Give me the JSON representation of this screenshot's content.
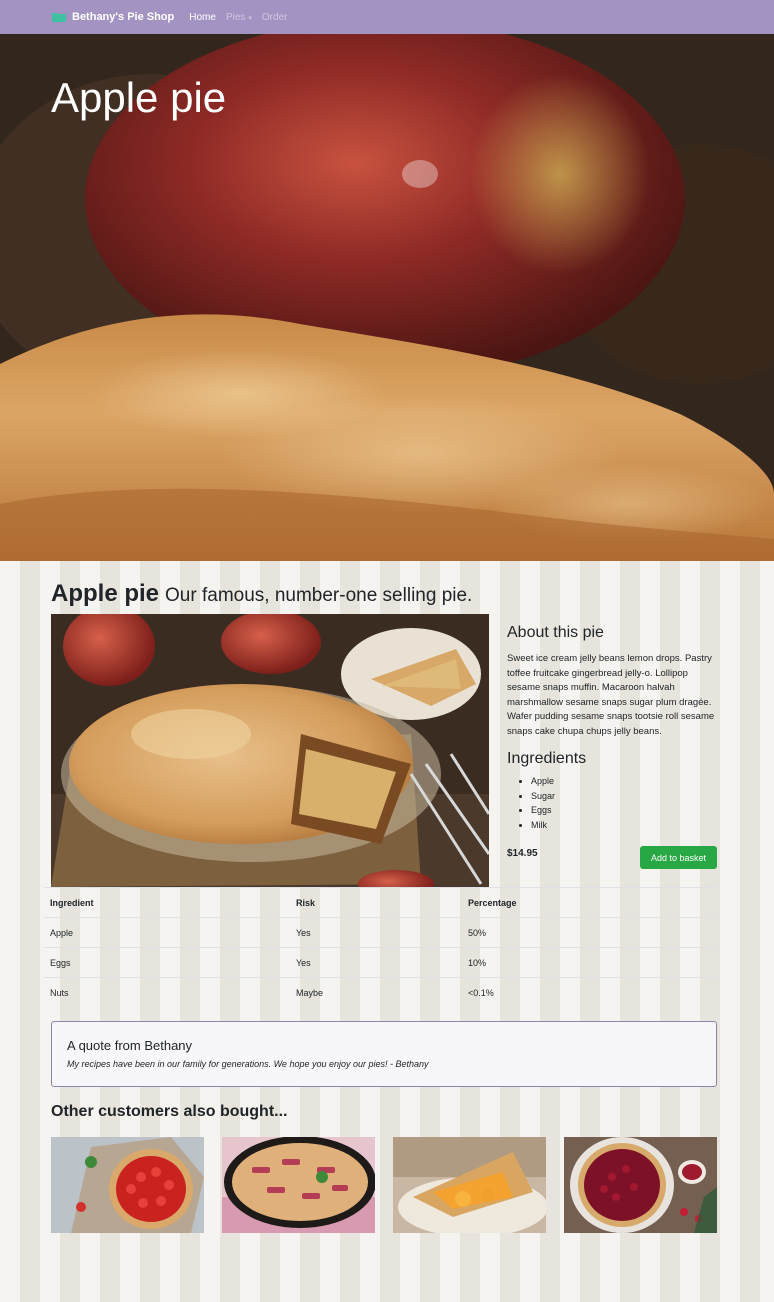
{
  "navbar": {
    "brand": "Bethany's Pie Shop",
    "links": [
      {
        "label": "Home"
      },
      {
        "label": "Pies"
      },
      {
        "label": "Order"
      }
    ]
  },
  "hero": {
    "title": "Apple pie"
  },
  "product": {
    "name": "Apple pie",
    "tagline": "Our famous, number-one selling pie.",
    "about_heading": "About this pie",
    "description": "Sweet ice cream jelly beans lemon drops. Pastry toffee fruitcake gingerbread jelly-o. Lollipop sesame snaps muffin. Macaroon halvah marshmallow sesame snaps sugar plum dragée. Wafer pudding sesame snaps tootsie roll sesame snaps cake chupa chups jelly beans.",
    "ingredients_heading": "Ingredients",
    "ingredients": [
      "Apple",
      "Sugar",
      "Eggs",
      "Milk"
    ],
    "price": "$14.95",
    "add_button": "Add to basket"
  },
  "allergy_table": {
    "headers": [
      "Ingredient",
      "Risk",
      "Percentage"
    ],
    "rows": [
      [
        "Apple",
        "Yes",
        "50%"
      ],
      [
        "Eggs",
        "Yes",
        "10%"
      ],
      [
        "Nuts",
        "Maybe",
        "<0.1%"
      ]
    ]
  },
  "quote": {
    "heading": "A quote from Bethany",
    "text": "My recipes have been in our family for generations. We hope you enjoy our pies! - Bethany"
  },
  "also_bought": {
    "heading": "Other customers also bought..."
  },
  "colors": {
    "navbar": "#a293c2",
    "button": "#28a745",
    "stripe_light": "#f6f4f1",
    "stripe_dark": "#e6e4dc"
  }
}
